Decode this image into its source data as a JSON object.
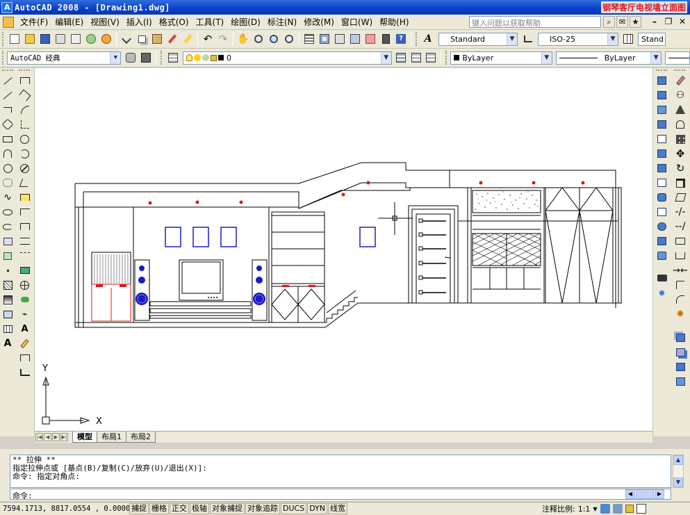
{
  "window": {
    "title": "AutoCAD 2008 - [Drawing1.dwg]",
    "watermark": "钢琴客厅电视墙立面图"
  },
  "menubar": {
    "items": [
      "文件(F)",
      "编辑(E)",
      "视图(V)",
      "插入(I)",
      "格式(O)",
      "工具(T)",
      "绘图(D)",
      "标注(N)",
      "修改(M)",
      "窗口(W)",
      "帮助(H)"
    ],
    "help_search_placeholder": "键入问题以获取帮助"
  },
  "toolbar_standard": {
    "text_style": "Standard",
    "dim_style": "ISO-25",
    "table_style": "Stand"
  },
  "toolbar_layers": {
    "workspace": "AutoCAD 经典",
    "layer": "0",
    "color": "ByLayer",
    "linetype": "ByLayer"
  },
  "layout_tabs": [
    "模型",
    "布局1",
    "布局2"
  ],
  "active_tab": "模型",
  "ucs": {
    "x_label": "X",
    "y_label": "Y"
  },
  "command": {
    "history": [
      "** 拉伸 **",
      "指定拉伸点或 [基点(B)/复制(C)/放弃(U)/退出(X)]:",
      "命令: 指定对角点:"
    ],
    "prompt": "命令:"
  },
  "status": {
    "coords": "7594.1713,  8817.0554 , 0.0000",
    "buttons": [
      "捕捉",
      "栅格",
      "正交",
      "极轴",
      "对象捕捉",
      "对象追踪",
      "DUCS",
      "DYN",
      "线宽"
    ],
    "annotation_scale_label": "注释比例:",
    "annotation_scale": "1:1"
  },
  "colors": {
    "title_bar": "#0a3fc4",
    "chrome": "#ece9d8",
    "canvas": "#ffffff",
    "accent_red": "#e01818",
    "accent_blue": "#1a1acc"
  }
}
